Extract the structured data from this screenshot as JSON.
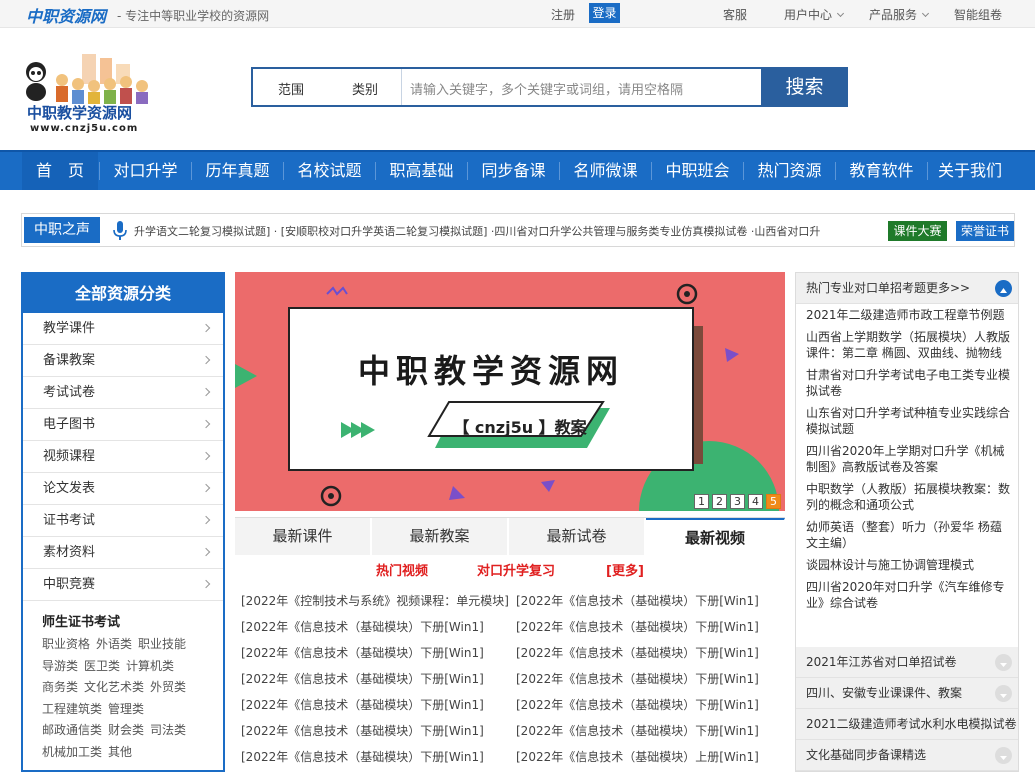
{
  "topbar": {
    "brand": "中职资源网",
    "slogan": "- 专注中等职业学校的资源网",
    "register": "注册",
    "login": "登录",
    "service": "客服",
    "user_center": "用户中心",
    "products": "产品服务",
    "smart_paper": "智能组卷"
  },
  "logo": {
    "caption": "中职教学资源网",
    "url_text": "www.cnzj5u.com"
  },
  "search": {
    "scope_label": "范围",
    "category_label": "类别",
    "placeholder": "请输入关键字，多个关键字或词组，请用空格隔",
    "button": "搜索"
  },
  "nav": [
    "首　页",
    "对口升学",
    "历年真题",
    "名校试题",
    "职高基础",
    "同步备课",
    "名师微课",
    "中职班会",
    "热门资源",
    "教育软件",
    "关于我们"
  ],
  "voice": {
    "label": "中职之声",
    "marquee": "升学语文二轮复习模拟试题] · [安顺职校对口升学英语二轮复习模拟试题] ·四川省对口升学公共管理与服务类专业仿真模拟试卷 ·山西省对口升",
    "btn_contest": "课件大赛",
    "btn_cert": "荣誉证书"
  },
  "sidebar": {
    "title": "全部资源分类",
    "items": [
      "教学课件",
      "备课教案",
      "考试试卷",
      "电子图书",
      "视频课程",
      "论文发表",
      "证书考试",
      "素材资料",
      "中职竞赛"
    ],
    "cert_title": "师生证书考试",
    "cert_tags": [
      "职业资格",
      "外语类",
      "职业技能",
      "导游类",
      "医卫类",
      "计算机类",
      "商务类",
      "文化艺术类",
      "外贸类",
      "工程建筑类",
      "管理类",
      "邮政通信类",
      "财会类",
      "司法类",
      "机械加工类",
      "其他"
    ]
  },
  "banner": {
    "title": "中职教学资源网",
    "subtitle": "【 cnzj5u 】教案",
    "pages": [
      "1",
      "2",
      "3",
      "4",
      "5"
    ]
  },
  "tabs": [
    "最新课件",
    "最新教案",
    "最新试卷",
    "最新视频"
  ],
  "subtabs": {
    "hot_video": "热门视频",
    "exam_review": "对口升学复习",
    "more": "[更多]"
  },
  "video_list": {
    "left": [
      "[2022年《控制技术与系统》视频课程：单元模块]",
      "[2022年《信息技术（基础模块）下册[Win1]",
      "[2022年《信息技术（基础模块）下册[Win1]",
      "[2022年《信息技术（基础模块）下册[Win1]",
      "[2022年《信息技术（基础模块）下册[Win1]",
      "[2022年《信息技术（基础模块）下册[Win1]",
      "[2022年《信息技术（基础模块）下册[Win1]"
    ],
    "right": [
      "[2022年《信息技术（基础模块）下册[Win1]",
      "[2022年《信息技术（基础模块）下册[Win1]",
      "[2022年《信息技术（基础模块）下册[Win1]",
      "[2022年《信息技术（基础模块）下册[Win1]",
      "[2022年《信息技术（基础模块）下册[Win1]",
      "[2022年《信息技术（基础模块）下册[Win1]",
      "[2022年《信息技术（基础模块）上册[Win1]"
    ]
  },
  "right_panel": {
    "open_title": "热门专业对口单招考题更多>>",
    "open_items": [
      "2021年二级建造师市政工程章节例题",
      "山西省上学期数学（拓展模块）人教版课件：第二章 椭圆、双曲线、抛物线",
      "甘肃省对口升学考试电子电工类专业模拟试卷",
      "山东省对口升学考试种植专业实践综合模拟试题",
      "四川省2020年上学期对口升学《机械制图》高教版试卷及答案",
      "中职数学（人教版）拓展模块教案：数列的概念和通项公式",
      "幼师英语（整套）听力（孙爱华 杨蕴文主编）",
      "谈园林设计与施工协调管理模式",
      "四川省2020年对口升学《汽车维修专业》综合试卷"
    ],
    "collapsed": [
      "2021年江苏省对口单招试卷",
      "四川、安徽专业课课件、教案",
      "2021二级建造师考试水利水电模拟试卷",
      "文化基础同步备课精选"
    ]
  }
}
